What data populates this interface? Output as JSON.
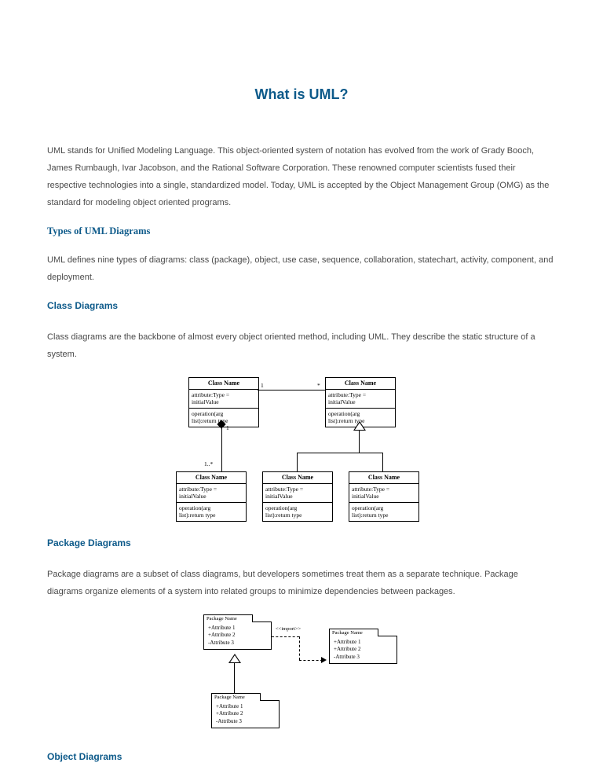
{
  "title": "What is UML?",
  "intro": "UML stands for Unified Modeling Language. This object-oriented system of notation has evolved from the work of Grady Booch, James Rumbaugh, Ivar Jacobson, and the Rational Software Corporation. These renowned computer scientists fused their respective technologies into a single, standardized model. Today, UML is accepted by the Object Management Group (OMG) as the standard for modeling object oriented programs.",
  "types_heading": "Types of UML Diagrams",
  "types_body": "UML defines nine types of diagrams: class (package), object, use case, sequence, collaboration, statechart, activity, component, and deployment.",
  "class_heading": "Class Diagrams",
  "class_body": "Class diagrams are the backbone of almost every object oriented method, including UML. They describe the static structure of a system.",
  "package_heading": "Package Diagrams",
  "package_body": "Package diagrams are a subset of class diagrams, but developers sometimes treat them as a separate technique. Package diagrams organize elements of a system into related groups to minimize dependencies between packages.",
  "object_heading": "Object Diagrams",
  "uml_class": {
    "header": "Class Name",
    "attr1": "attribute:Type =",
    "attr2": "initialValue",
    "op1": "operation(arg",
    "op2": "list):return type",
    "mult_one": "1",
    "mult_many": "1..*",
    "mult_star": "*"
  },
  "uml_pkg": {
    "tab": "Package Name",
    "a1": "+Attribute 1",
    "a2": "+Attribute 2",
    "a3": "-Attribute 3",
    "import": "<<import>>"
  }
}
